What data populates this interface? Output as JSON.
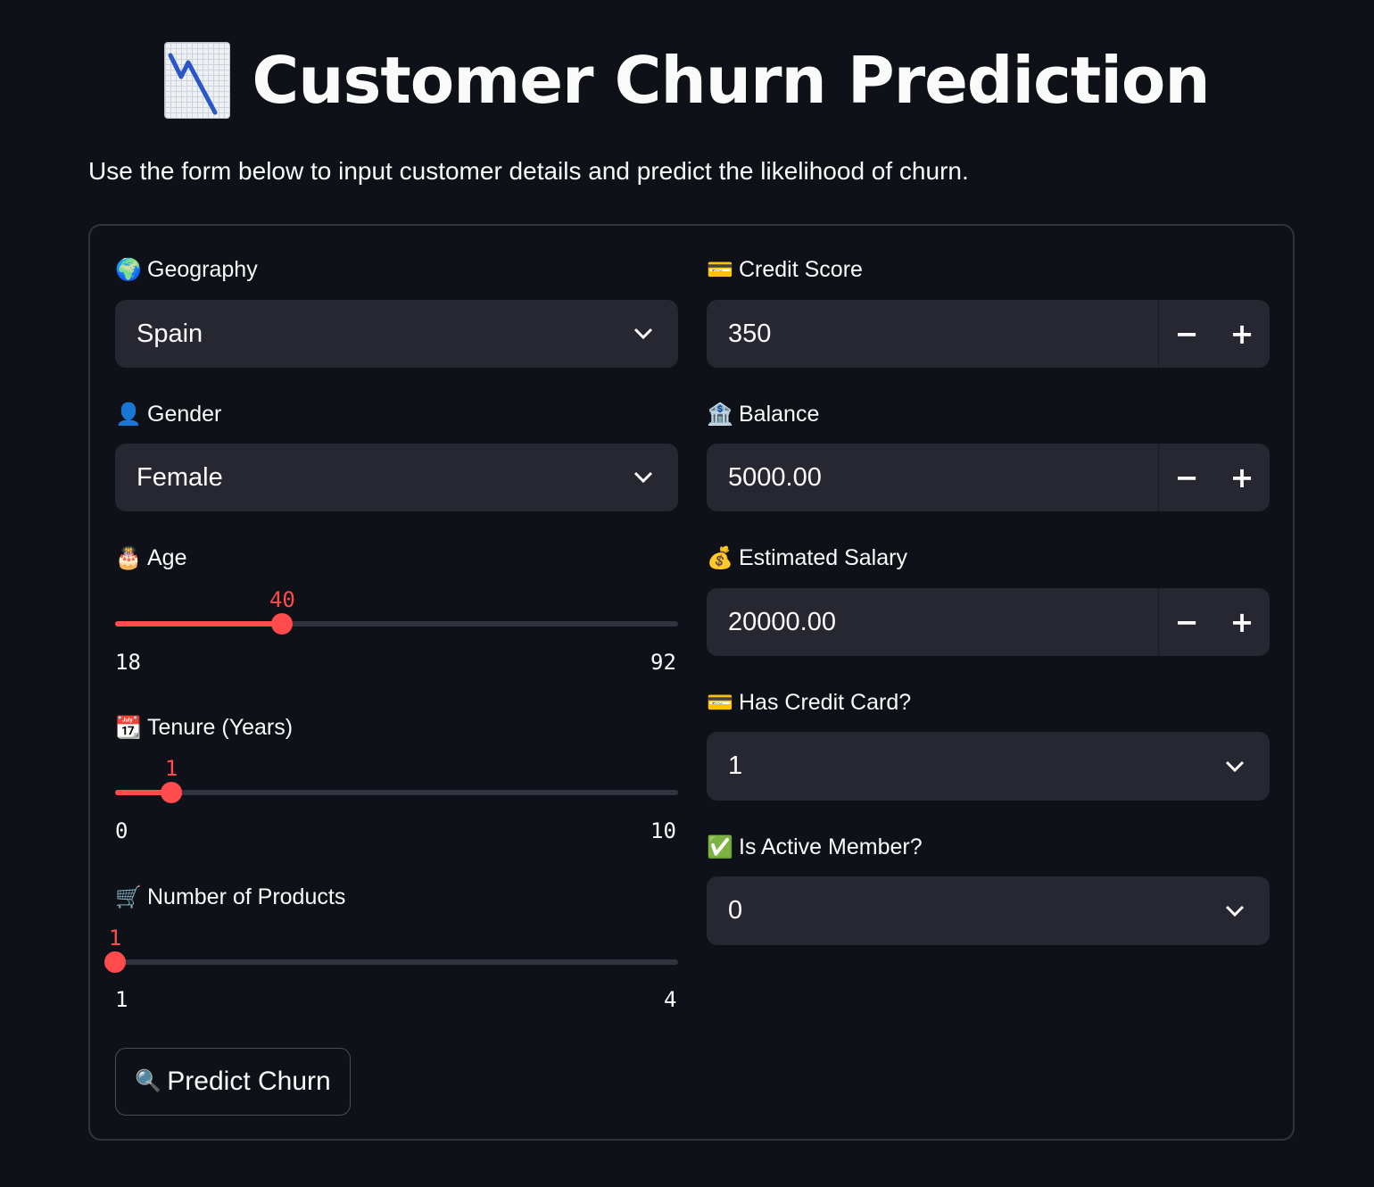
{
  "header": {
    "title_icon": "chart-decreasing-icon",
    "title": "Customer Churn Prediction",
    "subtitle": "Use the form below to input customer details and predict the likelihood of churn."
  },
  "form": {
    "geography": {
      "icon": "globe-icon",
      "label": "Geography",
      "value": "Spain"
    },
    "gender": {
      "icon": "user-icon",
      "label": "Gender",
      "value": "Female"
    },
    "age": {
      "icon": "cake-icon",
      "label": "Age",
      "value": "40",
      "min": "18",
      "max": "92",
      "fraction": 0.297
    },
    "tenure": {
      "icon": "calendar-icon",
      "label": "Tenure (Years)",
      "value": "1",
      "min": "0",
      "max": "10",
      "fraction": 0.1
    },
    "num_products": {
      "icon": "cart-icon",
      "label": "Number of Products",
      "value": "1",
      "min": "1",
      "max": "4",
      "fraction": 0.0
    },
    "credit_score": {
      "icon": "credit-card-icon",
      "label": "Credit Score",
      "value": "350",
      "minus": "−",
      "plus": "+"
    },
    "balance": {
      "icon": "bank-icon",
      "label": "Balance",
      "value": "5000.00",
      "minus": "−",
      "plus": "+"
    },
    "salary": {
      "icon": "money-bag-icon",
      "label": "Estimated Salary",
      "value": "20000.00",
      "minus": "−",
      "plus": "+"
    },
    "has_cr_card": {
      "icon": "credit-card-icon",
      "label": "Has Credit Card?",
      "value": "1"
    },
    "is_active": {
      "icon": "check-mark-icon",
      "label": "Is Active Member?",
      "value": "0"
    },
    "submit": {
      "icon": "magnifier-icon",
      "label": "Predict Churn"
    }
  },
  "colors": {
    "accent": "#ff4b4b",
    "background": "#0e1117",
    "input_bg": "#262730",
    "border": "#31333f"
  }
}
